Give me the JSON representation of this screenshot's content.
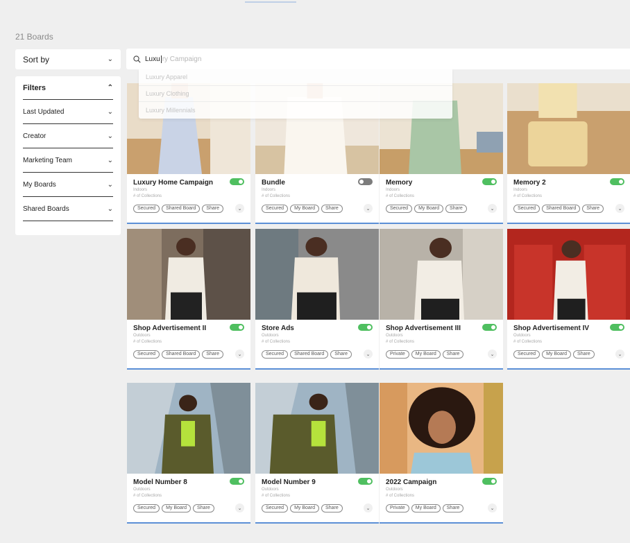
{
  "boards_count": "21 Boards",
  "sort": {
    "label": "Sort by"
  },
  "search": {
    "typed": "Luxu",
    "hint": "ry Campaign",
    "suggestions": [
      "Luxury Apparel",
      "Luxury Clothing",
      "Luxury Millennials"
    ]
  },
  "filters": {
    "title": "Filters",
    "items": [
      "Last Updated",
      "Creator",
      "Marketing Team",
      "My Boards",
      "Shared Boards"
    ]
  },
  "colors": {
    "accent": "#5b8fd6",
    "toggle_on": "#4fbf60",
    "toggle_off": "#7c7c7c"
  },
  "icons": {
    "search": "search-icon",
    "expand": "chevron-down-icon",
    "collapse": "chevron-up-icon"
  },
  "boards": [
    {
      "title": "Luxury Home Campaign",
      "sub": "Indoors",
      "collections": "# of Collections",
      "toggle": true,
      "tags": [
        "Secured",
        "Shared Board",
        "Share"
      ]
    },
    {
      "title": "Bundle",
      "sub": "Indoors",
      "collections": "# of Collections",
      "toggle": false,
      "tags": [
        "Secured",
        "My Board",
        "Share"
      ]
    },
    {
      "title": "Memory",
      "sub": "Indoors",
      "collections": "# of Collections",
      "toggle": true,
      "tags": [
        "Secured",
        "My Board",
        "Share"
      ]
    },
    {
      "title": "Memory 2",
      "sub": "Indoors",
      "collections": "# of Collections",
      "toggle": true,
      "tags": [
        "Secured",
        "Shared Board",
        "Share"
      ]
    },
    {
      "title": "Shop Advertisement II",
      "sub": "Outdoors",
      "collections": "# of Collections",
      "toggle": true,
      "tags": [
        "Secured",
        "Shared Board",
        "Share"
      ]
    },
    {
      "title": "Store Ads",
      "sub": "Outdoors",
      "collections": "# of Collections",
      "toggle": true,
      "tags": [
        "Secured",
        "Shared Board",
        "Share"
      ]
    },
    {
      "title": "Shop Advertisement III",
      "sub": "Outdoors",
      "collections": "# of Collections",
      "toggle": true,
      "tags": [
        "Private",
        "My Board",
        "Share"
      ]
    },
    {
      "title": "Shop Advertisement IV",
      "sub": "Outdoors",
      "collections": "# of Collections",
      "toggle": true,
      "tags": [
        "Secured",
        "My Board",
        "Share"
      ]
    },
    {
      "title": "Model Number 8",
      "sub": "Outdoors",
      "collections": "# of Collections",
      "toggle": true,
      "tags": [
        "Secured",
        "My Board",
        "Share"
      ]
    },
    {
      "title": "Model Number 9",
      "sub": "Outdoors",
      "collections": "# of Collections",
      "toggle": true,
      "tags": [
        "Secured",
        "My Board",
        "Share"
      ]
    },
    {
      "title": "2022 Campaign",
      "sub": "Outdoors",
      "collections": "# of Collections",
      "toggle": true,
      "tags": [
        "Private",
        "My Board",
        "Share"
      ]
    }
  ]
}
